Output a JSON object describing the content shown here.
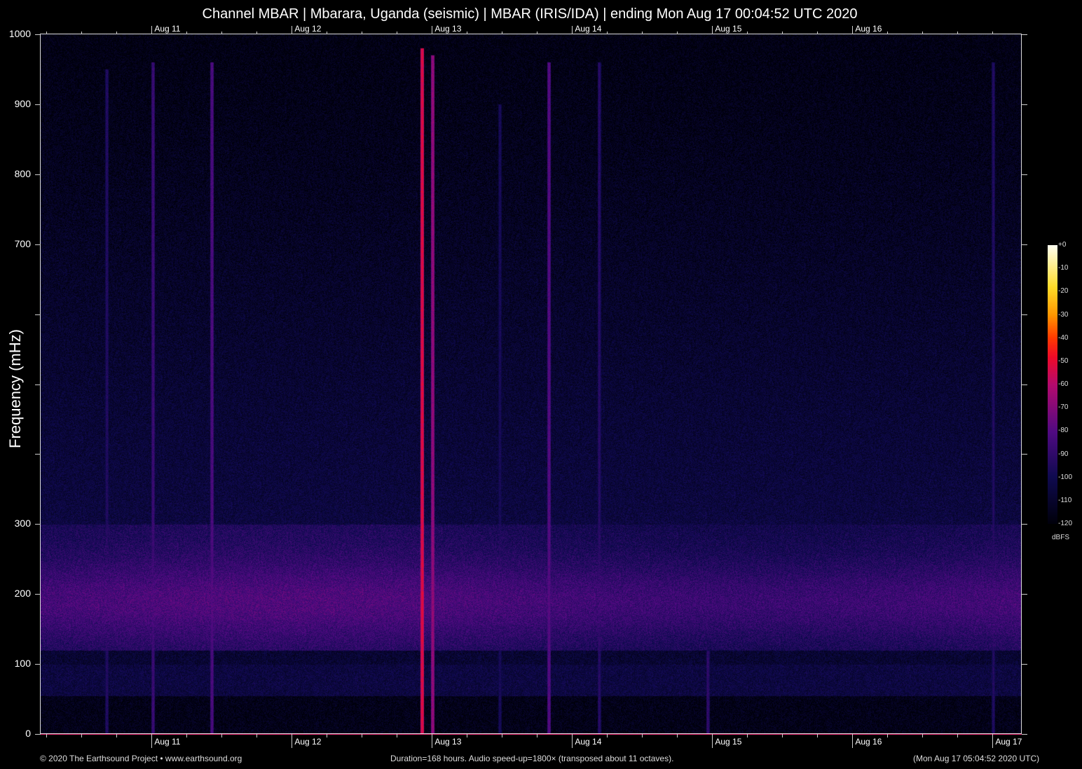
{
  "chart_data": {
    "type": "heatmap",
    "title": "Channel MBAR | Mbarara, Uganda (seismic) | MBAR (IRIS/IDA) | ending Mon Aug 17 00:04:52 UTC 2020",
    "ylabel": "Frequency (mHz)",
    "ylim": [
      0,
      1000
    ],
    "y_ticks": [
      {
        "v": 1000,
        "label": "1000"
      },
      {
        "v": 900,
        "label": "900"
      },
      {
        "v": 800,
        "label": "800"
      },
      {
        "v": 700,
        "label": "700"
      },
      {
        "v": 600,
        "label": ""
      },
      {
        "v": 500,
        "label": ""
      },
      {
        "v": 400,
        "label": ""
      },
      {
        "v": 300,
        "label": "300"
      },
      {
        "v": 200,
        "label": "200"
      },
      {
        "v": 100,
        "label": "100"
      },
      {
        "v": 0,
        "label": "0"
      }
    ],
    "xlim_hours": [
      0,
      168
    ],
    "x_ticks": [
      {
        "h": 19,
        "label": "Aug 11"
      },
      {
        "h": 43,
        "label": "Aug 12"
      },
      {
        "h": 67,
        "label": "Aug 13"
      },
      {
        "h": 91,
        "label": "Aug 14"
      },
      {
        "h": 115,
        "label": "Aug 15"
      },
      {
        "h": 139,
        "label": "Aug 16"
      },
      {
        "h": 163,
        "label": "Aug 17"
      }
    ],
    "x_ticks_top_count": 6,
    "colorbar": {
      "unit": "dBFS",
      "range": [
        -120,
        0
      ],
      "ticks": [
        "+0",
        "-10",
        "-20",
        "-30",
        "-40",
        "-50",
        "-60",
        "-70",
        "-80",
        "-90",
        "-100",
        "-110",
        "-120"
      ]
    },
    "events": [
      {
        "h": 65.3,
        "db": -50,
        "fmax": 980
      },
      {
        "h": 67.1,
        "db": -65,
        "fmax": 970
      },
      {
        "h": 87.0,
        "db": -78,
        "fmax": 960
      },
      {
        "h": 29.3,
        "db": -80,
        "fmax": 960
      },
      {
        "h": 19.2,
        "db": -85,
        "fmax": 960
      },
      {
        "h": 95.6,
        "db": -90,
        "fmax": 960
      },
      {
        "h": 11.3,
        "db": -92,
        "fmax": 950
      },
      {
        "h": 114.2,
        "db": -88,
        "fmax": 120
      },
      {
        "h": 78.6,
        "db": -95,
        "fmax": 900
      },
      {
        "h": 163.1,
        "db": -92,
        "fmax": 960
      }
    ]
  },
  "footer": {
    "copyright": "© 2020 The Earthsound Project • www.earthsound.org",
    "duration": "Duration=168 hours. Audio speed-up=1800× (transposed about 11 octaves).",
    "timestamp": "(Mon Aug 17 05:04:52 2020 UTC)"
  }
}
